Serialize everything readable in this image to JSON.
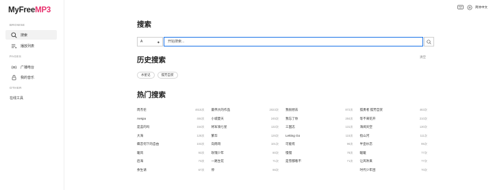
{
  "logo": {
    "brand": "MyFree",
    "suffix": "MP3"
  },
  "sidebar": {
    "sections": [
      {
        "title": "BROWSE",
        "items": [
          {
            "label": "搜索",
            "icon": "search-icon",
            "active": true
          },
          {
            "label": "播放列表",
            "icon": "playlist-icon",
            "active": false
          }
        ]
      },
      {
        "title": "PAGES",
        "items": [
          {
            "label": "广播电台",
            "icon": "radio-icon",
            "active": false
          },
          {
            "label": "我的音乐",
            "icon": "lock-icon",
            "active": false
          }
        ]
      },
      {
        "title": "OTHER",
        "items": [
          {
            "label": "在线工具",
            "icon": "",
            "active": false
          }
        ]
      }
    ]
  },
  "topbar": {
    "icons": [
      "keyboard-icon",
      "add-icon"
    ],
    "language": "简体中文"
  },
  "search": {
    "title": "搜索",
    "source_selected": "A",
    "placeholder": "开始搜索...",
    "value": ""
  },
  "history": {
    "title": "历史搜索",
    "clear_label": "清空",
    "tags": [
      "水星记",
      "孤芳自赏"
    ]
  },
  "hot": {
    "title": "热门搜索",
    "columns": [
      [
        {
          "name": "周杰伦",
          "count": "4615次"
        },
        {
          "name": "Aespa",
          "count": "484次"
        },
        {
          "name": "是蓝的吗",
          "count": "154次"
        },
        {
          "name": "大海",
          "count": "128次"
        },
        {
          "name": "蝶恋何下的自由",
          "count": "103次"
        },
        {
          "name": "暖风",
          "count": "93次"
        },
        {
          "name": "后海",
          "count": "73次"
        },
        {
          "name": "余生请",
          "count": "67次"
        }
      ],
      [
        {
          "name": "最伟大的作品",
          "count": "2023次"
        },
        {
          "name": "小城夏天",
          "count": "245次"
        },
        {
          "name": "将军骑七星",
          "count": "132次"
        },
        {
          "name": "繁华",
          "count": "126次"
        },
        {
          "name": "向雨哥",
          "count": "101次"
        },
        {
          "name": "玫瑰少年",
          "count": "80次"
        },
        {
          "name": "一路生花",
          "count": "71次"
        },
        {
          "name": "停",
          "count": "66次"
        }
      ],
      [
        {
          "name": "我很想去",
          "count": "872次"
        },
        {
          "name": "我忘了你",
          "count": "284次"
        },
        {
          "name": "三国志",
          "count": "131次"
        },
        {
          "name": "Letting Go",
          "count": "115次"
        },
        {
          "name": "可能有",
          "count": "96次"
        },
        {
          "name": "慢慢",
          "count": "78次"
        },
        {
          "name": "是雪都看不",
          "count": "71次"
        }
      ],
      [
        {
          "name": "孤勇者 孤芳自赏",
          "count": "463次"
        },
        {
          "name": "等不来花开",
          "count": "210次"
        },
        {
          "name": "海阔天空",
          "count": "130次"
        },
        {
          "name": "指山河",
          "count": "111次"
        },
        {
          "name": "半壶纱恋",
          "count": "95次"
        },
        {
          "name": "暖暖",
          "count": "77次"
        },
        {
          "name": "让风吹来",
          "count": "77次"
        },
        {
          "name": "时代少年团",
          "count": "70次"
        }
      ]
    ]
  }
}
